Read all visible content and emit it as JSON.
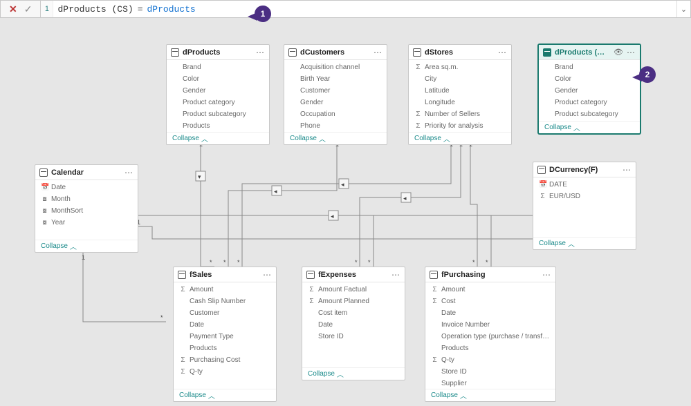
{
  "formula": {
    "line_no": "1",
    "lhs": "dProducts (CS)",
    "eq": "=",
    "rhs": "dProducts"
  },
  "collapse_label": "Collapse",
  "badges": {
    "b1": "1",
    "b2": "2"
  },
  "tables": {
    "dProducts": {
      "title": "dProducts",
      "fields": [
        {
          "icon": "",
          "label": "Brand"
        },
        {
          "icon": "",
          "label": "Color"
        },
        {
          "icon": "",
          "label": "Gender"
        },
        {
          "icon": "",
          "label": "Product category"
        },
        {
          "icon": "",
          "label": "Product subcategory"
        },
        {
          "icon": "",
          "label": "Products"
        }
      ]
    },
    "dCustomers": {
      "title": "dCustomers",
      "fields": [
        {
          "icon": "",
          "label": "Acquisition channel"
        },
        {
          "icon": "",
          "label": "Birth Year"
        },
        {
          "icon": "",
          "label": "Customer"
        },
        {
          "icon": "",
          "label": "Gender"
        },
        {
          "icon": "",
          "label": "Occupation"
        },
        {
          "icon": "",
          "label": "Phone"
        }
      ]
    },
    "dStores": {
      "title": "dStores",
      "fields": [
        {
          "icon": "Σ",
          "label": "Area sq.m."
        },
        {
          "icon": "",
          "label": "City"
        },
        {
          "icon": "",
          "label": "Latitude"
        },
        {
          "icon": "",
          "label": "Longitude"
        },
        {
          "icon": "Σ",
          "label": "Number of Sellers"
        },
        {
          "icon": "Σ",
          "label": "Priority for analysis"
        }
      ]
    },
    "dProductsCS": {
      "title": "dProducts (CS)",
      "fields": [
        {
          "icon": "",
          "label": "Brand"
        },
        {
          "icon": "",
          "label": "Color"
        },
        {
          "icon": "",
          "label": "Gender"
        },
        {
          "icon": "",
          "label": "Product category"
        },
        {
          "icon": "",
          "label": "Product subcategory"
        }
      ]
    },
    "Calendar": {
      "title": "Calendar",
      "fields": [
        {
          "icon": "📅",
          "label": "Date"
        },
        {
          "icon": "⧇",
          "label": "Month"
        },
        {
          "icon": "⧇",
          "label": "MonthSort"
        },
        {
          "icon": "⧇",
          "label": "Year"
        }
      ]
    },
    "DCurrency": {
      "title": "DCurrency(F)",
      "fields": [
        {
          "icon": "📅",
          "label": "DATE"
        },
        {
          "icon": "Σ",
          "label": "EUR/USD"
        }
      ]
    },
    "fSales": {
      "title": "fSales",
      "fields": [
        {
          "icon": "Σ",
          "label": "Amount"
        },
        {
          "icon": "",
          "label": "Cash Slip Number"
        },
        {
          "icon": "",
          "label": "Customer"
        },
        {
          "icon": "",
          "label": "Date"
        },
        {
          "icon": "",
          "label": "Payment Type"
        },
        {
          "icon": "",
          "label": "Products"
        },
        {
          "icon": "Σ",
          "label": "Purchasing Cost"
        },
        {
          "icon": "Σ",
          "label": "Q-ty"
        }
      ]
    },
    "fExpenses": {
      "title": "fExpenses",
      "fields": [
        {
          "icon": "Σ",
          "label": "Amount Factual"
        },
        {
          "icon": "Σ",
          "label": "Amount Planned"
        },
        {
          "icon": "",
          "label": "Cost item"
        },
        {
          "icon": "",
          "label": "Date"
        },
        {
          "icon": "",
          "label": "Store ID"
        }
      ]
    },
    "fPurchasing": {
      "title": "fPurchasing",
      "fields": [
        {
          "icon": "Σ",
          "label": "Amount"
        },
        {
          "icon": "Σ",
          "label": "Cost"
        },
        {
          "icon": "",
          "label": "Date"
        },
        {
          "icon": "",
          "label": "Invoice Number"
        },
        {
          "icon": "",
          "label": "Operation type (purchase / transf…"
        },
        {
          "icon": "",
          "label": "Products"
        },
        {
          "icon": "Σ",
          "label": "Q-ty"
        },
        {
          "icon": "",
          "label": "Store ID"
        },
        {
          "icon": "",
          "label": "Supplier"
        }
      ]
    }
  }
}
